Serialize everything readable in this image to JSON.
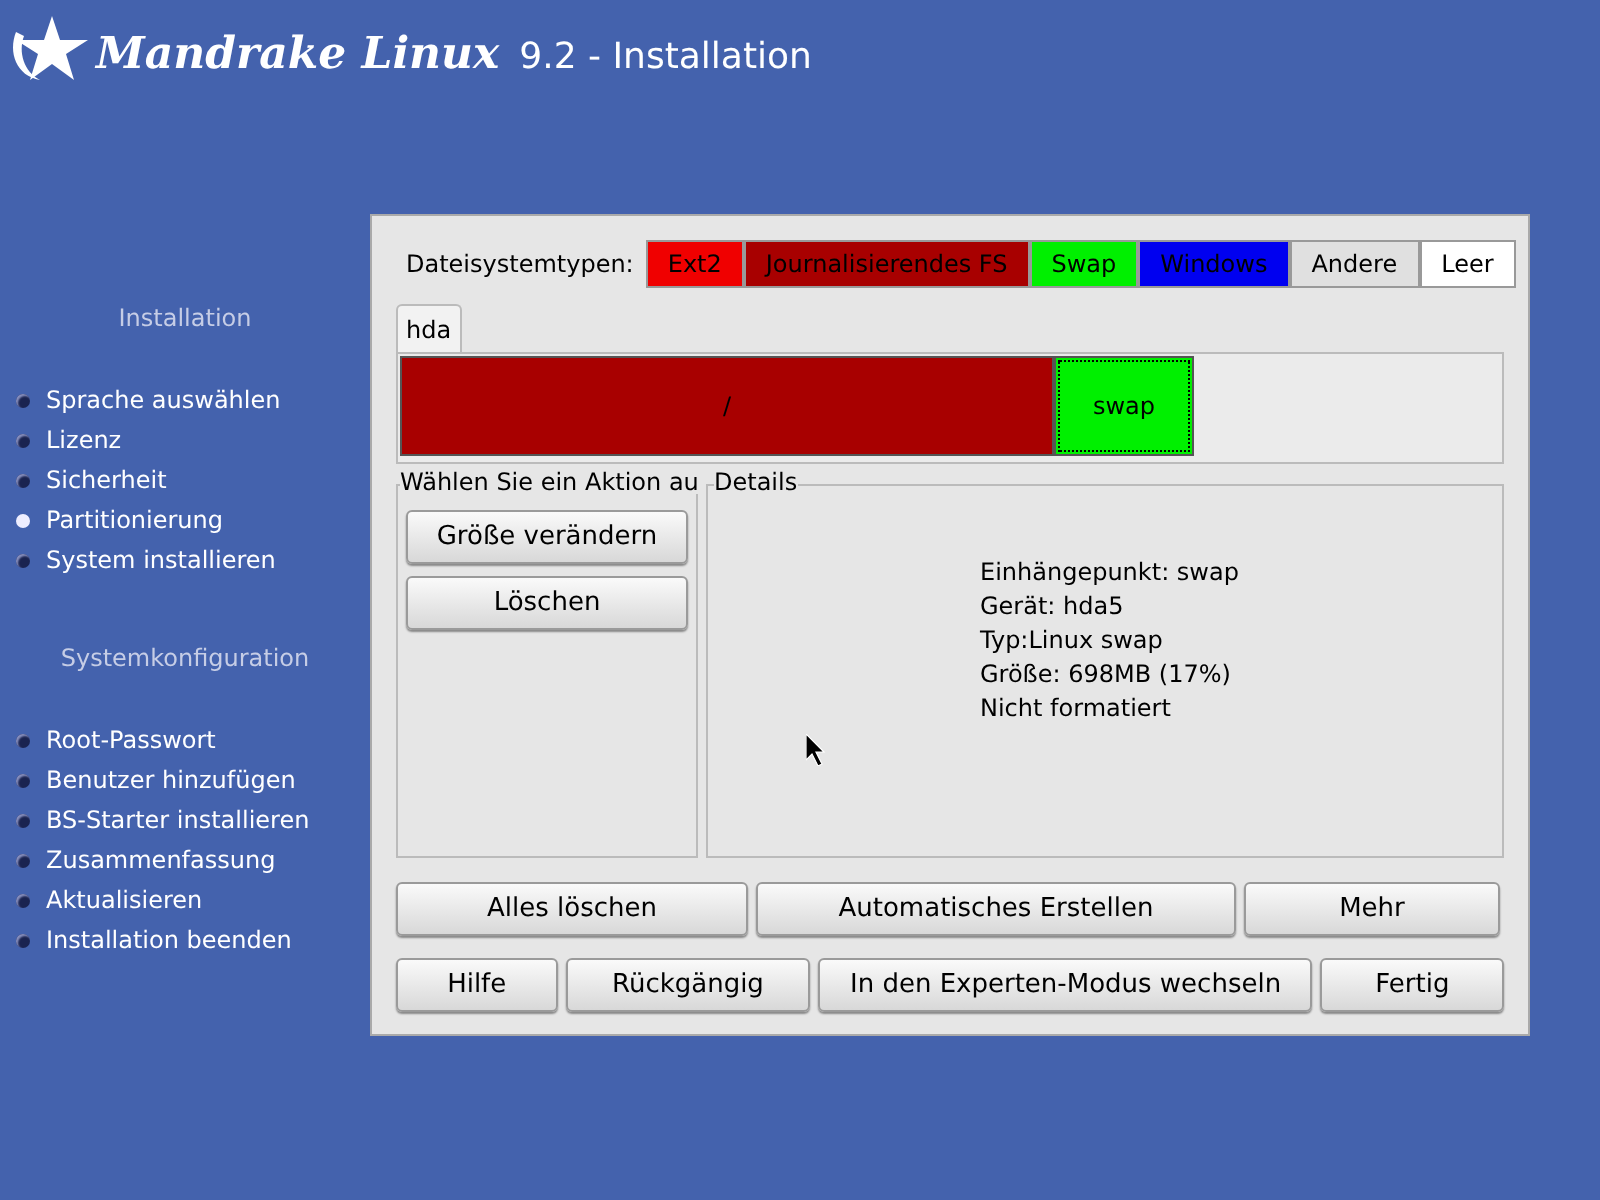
{
  "header": {
    "logo": "Mandrake Linux",
    "title": "9.2 - Installation"
  },
  "sidebar": {
    "sections": [
      {
        "heading": "Installation",
        "items": [
          {
            "label": "Sprache auswählen",
            "selected": false
          },
          {
            "label": "Lizenz",
            "selected": false
          },
          {
            "label": "Sicherheit",
            "selected": false
          },
          {
            "label": "Partitionierung",
            "selected": true
          },
          {
            "label": "System installieren",
            "selected": false
          }
        ]
      },
      {
        "heading": "Systemkonfiguration",
        "items": [
          {
            "label": "Root-Passwort",
            "selected": false
          },
          {
            "label": "Benutzer hinzufügen",
            "selected": false
          },
          {
            "label": "BS-Starter installieren",
            "selected": false
          },
          {
            "label": "Zusammenfassung",
            "selected": false
          },
          {
            "label": "Aktualisieren",
            "selected": false
          },
          {
            "label": "Installation beenden",
            "selected": false
          }
        ]
      }
    ]
  },
  "filesystem_types": {
    "label": "Dateisystemtypen:",
    "types": [
      {
        "label": "Ext2",
        "color": "#f00000"
      },
      {
        "label": "Journalisierendes FS",
        "color": "#a80000"
      },
      {
        "label": "Swap",
        "color": "#00f000"
      },
      {
        "label": "Windows",
        "color": "#0000f0"
      },
      {
        "label": "Andere",
        "color": "#e0e0e0"
      },
      {
        "label": "Leer",
        "color": "#ffffff"
      }
    ]
  },
  "disk_tabs": [
    {
      "label": "hda",
      "selected": true
    }
  ],
  "partitions": [
    {
      "label": "/",
      "color": "#a80000",
      "selected": false
    },
    {
      "label": "swap",
      "color": "#00f000",
      "selected": true
    }
  ],
  "actions": {
    "title": "Wählen Sie ein Aktion au",
    "buttons": [
      "Größe verändern",
      "Löschen"
    ]
  },
  "details": {
    "title": "Details",
    "lines": [
      "Einhängepunkt: swap",
      "Gerät: hda5",
      "Typ:Linux swap",
      "Größe: 698MB (17%)",
      "Nicht formatiert"
    ]
  },
  "buttons_row_1": [
    "Alles löschen",
    "Automatisches Erstellen",
    "Mehr"
  ],
  "buttons_row_2": [
    "Hilfe",
    "Rückgängig",
    "In den Experten-Modus wechseln",
    "Fertig"
  ]
}
